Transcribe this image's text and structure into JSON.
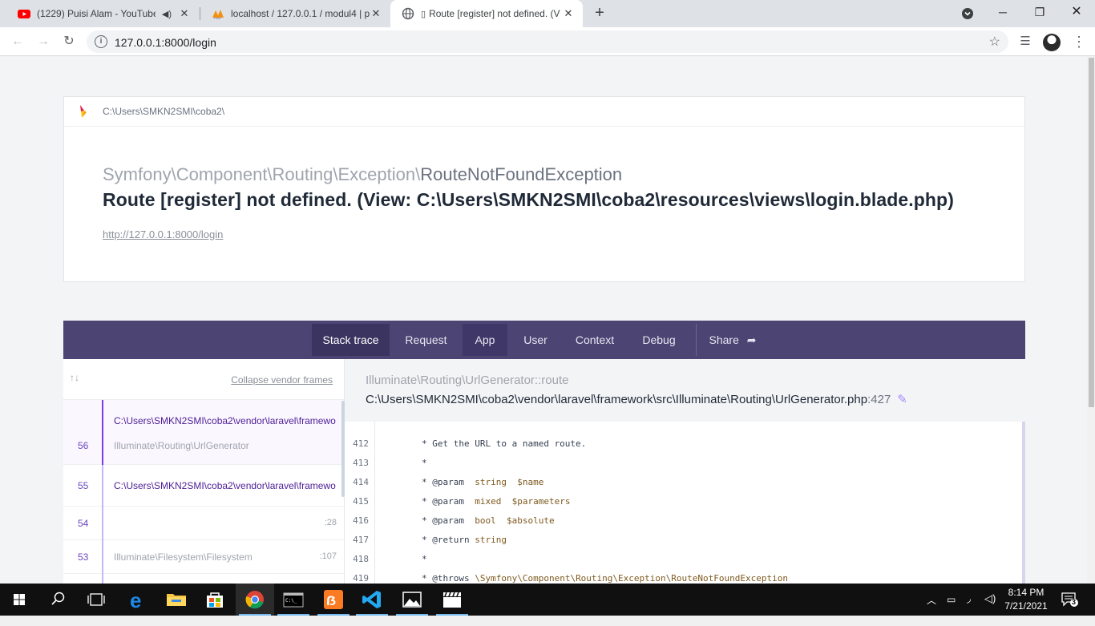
{
  "browser": {
    "tabs": [
      {
        "label": "(1229) Puisi Alam - YouTube",
        "icon": "youtube-icon",
        "active": false
      },
      {
        "label": "localhost / 127.0.0.1 / modul4 | p",
        "icon": "phpmyadmin-icon",
        "active": false
      },
      {
        "label": "Route [register] not defined. (V",
        "icon": "globe-icon",
        "active": true
      }
    ],
    "url": "127.0.0.1:8000/login"
  },
  "error": {
    "project_path": "C:\\Users\\SMKN2SMI\\coba2\\",
    "exception_namespace": "Symfony\\Component\\Routing\\Exception\\",
    "exception_short": "RouteNotFoundException",
    "message": "Route [register] not defined. (View: C:\\Users\\SMKN2SMI\\coba2\\resources\\views\\login.blade.php)",
    "url": "http://127.0.0.1:8000/login"
  },
  "tabs": {
    "stack_trace": "Stack trace",
    "request": "Request",
    "app": "App",
    "user": "User",
    "context": "Context",
    "debug": "Debug",
    "share": "Share"
  },
  "stack": {
    "collapse_label": "Collapse vendor frames",
    "frames": [
      {
        "number": "56",
        "file": "C:\\Users\\SMKN2SMI\\coba2\\vendor\\laravel\\framewo",
        "class": "Illuminate\\Routing\\UrlGenerator",
        "line": ""
      },
      {
        "number": "55",
        "file": "C:\\Users\\SMKN2SMI\\coba2\\vendor\\laravel\\framewo",
        "class": "",
        "line": ""
      },
      {
        "number": "54",
        "file": "",
        "class": "",
        "line": ":28"
      },
      {
        "number": "53",
        "file": "",
        "class": "Illuminate\\Filesystem\\Filesystem",
        "line": ":107"
      }
    ],
    "selected": {
      "class": "Illuminate\\Routing\\UrlGenerator::route",
      "file": "C:\\Users\\SMKN2SMI\\coba2\\vendor\\laravel\\framework\\src\\Illuminate\\Routing\\UrlGenerator.php",
      "line": ":427"
    },
    "code": [
      {
        "ln": "412",
        "text": "* Get the URL to a named route."
      },
      {
        "ln": "413",
        "text": "*"
      },
      {
        "ln": "414",
        "text": "* @param  string  $name"
      },
      {
        "ln": "415",
        "text": "* @param  mixed  $parameters"
      },
      {
        "ln": "416",
        "text": "* @param  bool  $absolute"
      },
      {
        "ln": "417",
        "text": "* @return string"
      },
      {
        "ln": "418",
        "text": "*"
      },
      {
        "ln": "419",
        "text": "* @throws \\Symfony\\Component\\Routing\\Exception\\RouteNotFoundException"
      }
    ]
  },
  "taskbar": {
    "time": "8:14 PM",
    "date": "7/21/2021",
    "notifications": "3"
  }
}
